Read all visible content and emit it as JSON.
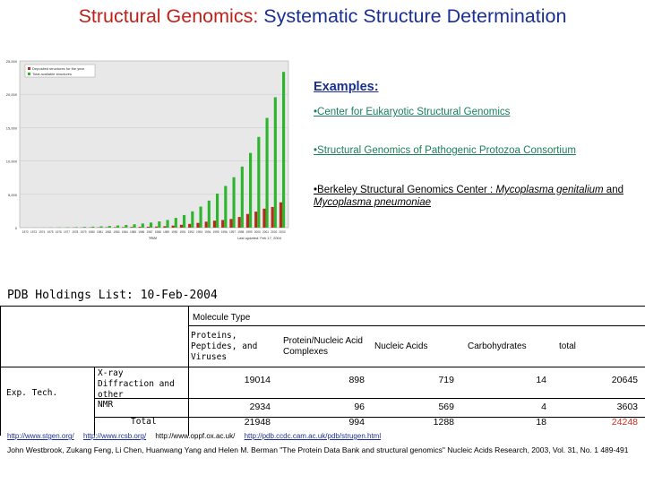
{
  "title": {
    "part1": "Structural Genomics:",
    "part2": "Systematic Structure Determination",
    "color1": "#c0211b",
    "color2": "#1a2f96"
  },
  "examples": {
    "heading": "Examples:",
    "items": [
      "•Center for Eukaryotic Structural Genomics",
      "•Structural Genomics of Pathogenic Protozoa Consortium",
      "•Berkeley Structural Genomics Center : Mycoplasma genitalium and Mycoplasma pneumoniae"
    ]
  },
  "chart_data": {
    "type": "bar",
    "legend": [
      "Deposited structures for the year",
      "Total available structures"
    ],
    "legend_colors": [
      "#b52d1a",
      "#2db52d"
    ],
    "ylim": [
      0,
      25000
    ],
    "yticks": [
      "25,000",
      "20,000",
      "15,000",
      "10,000",
      "5,000",
      "0"
    ],
    "xlabel": "Year",
    "x": [
      1972,
      1973,
      1974,
      1975,
      1976,
      1977,
      1978,
      1979,
      1980,
      1981,
      1982,
      1983,
      1984,
      1985,
      1986,
      1987,
      1988,
      1989,
      1990,
      1991,
      1992,
      1993,
      1994,
      1995,
      1996,
      1997,
      1998,
      1999,
      2000,
      2001,
      2002,
      2003
    ],
    "series": [
      {
        "name": "Deposited structures for the year",
        "values": [
          1,
          3,
          4,
          10,
          12,
          18,
          25,
          30,
          40,
          45,
          60,
          70,
          80,
          100,
          120,
          140,
          170,
          210,
          310,
          430,
          560,
          710,
          900,
          1050,
          1150,
          1300,
          1600,
          2050,
          2400,
          2850,
          3100,
          3800
        ]
      },
      {
        "name": "Total available structures",
        "values": [
          13,
          16,
          20,
          30,
          40,
          55,
          80,
          110,
          150,
          195,
          255,
          325,
          405,
          505,
          625,
          765,
          935,
          1150,
          1460,
          1890,
          2450,
          3160,
          4060,
          5110,
          6260,
          7560,
          9160,
          11210,
          13610,
          16460,
          19560,
          23360
        ]
      }
    ],
    "footnote": "Last updated: Feb 17, 2004"
  },
  "pdb": {
    "title": "PDB Holdings List: 10-Feb-2004",
    "molecule_type": "Molecule Type",
    "columns": [
      "Proteins, Peptides, and Viruses",
      "Protein/Nucleic Acid Complexes",
      "Nucleic Acids",
      "Carbohydrates",
      "total"
    ],
    "row_group": "Exp. Tech.",
    "rows": [
      {
        "label": "X-ray Diffraction and other",
        "values": [
          "19014",
          "898",
          "719",
          "14",
          "20645"
        ]
      },
      {
        "label": "NMR",
        "values": [
          "2934",
          "96",
          "569",
          "4",
          "3603"
        ]
      },
      {
        "label": "Total",
        "values": [
          "21948",
          "994",
          "1288",
          "18",
          "24248"
        ]
      }
    ]
  },
  "links": [
    "http://www.stgen.org/",
    "http://www.rcsb.org/",
    "http://www.oppf.ox.ac.uk/",
    "http://pdb.ccdc.cam.ac.uk/pdb/strugen.html"
  ],
  "citation": "John Westbrook, Zukang Feng, Li Chen, Huanwang Yang and Helen M. Berman \"The Protein Data Bank and structural genomics\" Nucleic Acids Research, 2003, Vol. 31, No. 1 489-491"
}
